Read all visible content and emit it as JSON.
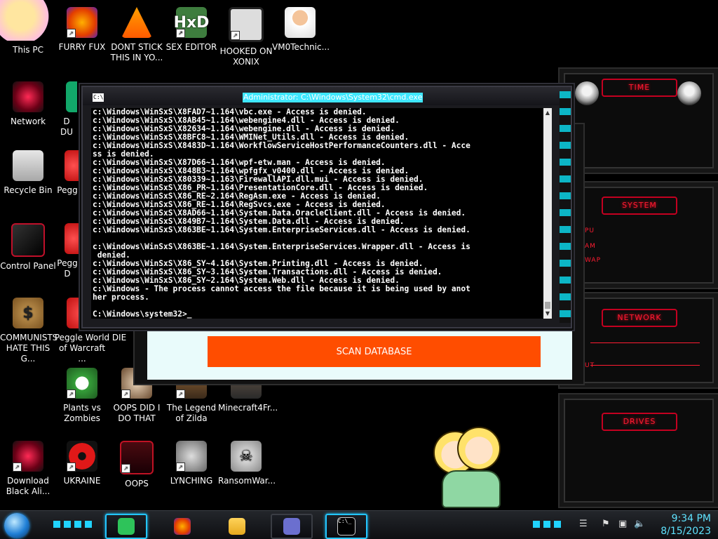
{
  "desktop": {
    "icons": [
      {
        "label": "This PC"
      },
      {
        "label": "FURRY FUX"
      },
      {
        "label": "DONT STICK THIS IN YO..."
      },
      {
        "label": "SEX EDITOR"
      },
      {
        "label": "HOOKED ON XONIX"
      },
      {
        "label": "VM0Technic..."
      },
      {
        "label": "Network"
      },
      {
        "label": "D DU"
      },
      {
        "label": "Recycle Bin"
      },
      {
        "label": "Pegg"
      },
      {
        "label": "Control Panel"
      },
      {
        "label": "Pegg D"
      },
      {
        "label": "COMMUNISTS HATE THIS G..."
      },
      {
        "label": "Peggle World of Warcraft ..."
      },
      {
        "label": "DIE"
      },
      {
        "label": "Plants vs Zombies"
      },
      {
        "label": "OOPS DID I DO THAT"
      },
      {
        "label": "The Legend of Zilda"
      },
      {
        "label": "Minecraft4Fr..."
      },
      {
        "label": "Download Black Ali..."
      },
      {
        "label": "UKRAINE"
      },
      {
        "label": "OOPS"
      },
      {
        "label": "LYNCHING"
      },
      {
        "label": "RansomWar..."
      }
    ],
    "hxd_text": "HxD"
  },
  "cmd": {
    "title": "Administrator: C:\\Windows\\System32\\cmd.exe",
    "icon_text": "C:\\",
    "lines": [
      "c:\\Windows\\WinSxS\\X8FAD7~1.164\\vbc.exe - Access is denied.",
      "c:\\Windows\\WinSxS\\X8AB45~1.164\\webengine4.dll - Access is denied.",
      "c:\\Windows\\WinSxS\\X82634~1.164\\webengine.dll - Access is denied.",
      "c:\\Windows\\WinSxS\\X8BFC8~1.164\\WMINet_Utils.dll - Access is denied.",
      "c:\\Windows\\WinSxS\\X8483D~1.164\\WorkflowServiceHostPerformanceCounters.dll - Acce",
      "ss is denied.",
      "c:\\Windows\\WinSxS\\X87D66~1.164\\wpf-etw.man - Access is denied.",
      "c:\\Windows\\WinSxS\\X848B3~1.164\\wpfgfx_v0400.dll - Access is denied.",
      "c:\\Windows\\WinSxS\\X80339~1.163\\FirewallAPI.dll.mui - Access is denied.",
      "c:\\Windows\\WinSxS\\X86_PR~1.164\\PresentationCore.dll - Access is denied.",
      "c:\\Windows\\WinSxS\\X86_RE~2.164\\RegAsm.exe - Access is denied.",
      "c:\\Windows\\WinSxS\\X86_RE~1.164\\RegSvcs.exe - Access is denied.",
      "c:\\Windows\\WinSxS\\X8AD66~1.164\\System.Data.OracleClient.dll - Access is denied.",
      "c:\\Windows\\WinSxS\\X849B7~1.164\\System.Data.dll - Access is denied.",
      "c:\\Windows\\WinSxS\\X863BE~1.164\\System.EnterpriseServices.dll - Access is denied.",
      "",
      "c:\\Windows\\WinSxS\\X863BE~1.164\\System.EnterpriseServices.Wrapper.dll - Access is",
      " denied.",
      "c:\\Windows\\WinSxS\\X86_SY~4.164\\System.Printing.dll - Access is denied.",
      "c:\\Windows\\WinSxS\\X86_SY~3.164\\System.Transactions.dll - Access is denied.",
      "c:\\Windows\\WinSxS\\X86_SY~2.164\\System.Web.dll - Access is denied.",
      "c:\\Windows - The process cannot access the file because it is being used by anot",
      "her process.",
      "",
      "C:\\Windows\\system32>_"
    ]
  },
  "scan_app": {
    "button_label": "SCAN DATABASE"
  },
  "gadgets": {
    "time_title": "TIME",
    "system_title": "SYSTEM",
    "system_labels": [
      "PU",
      "AM",
      "WAP"
    ],
    "network_title": "NETWORK",
    "network_label": "UT",
    "drives_title": "DRIVES"
  },
  "taskbar": {
    "cmd_icon_text": "C:\\_",
    "clock_time": "9:34 PM",
    "clock_date": "8/15/2023"
  },
  "colors": {
    "accent_cyan": "#23c6ff",
    "alien_red": "#ff1c32",
    "scan_orange": "#ff4d00",
    "title_highlight": "#3fe7ff"
  }
}
